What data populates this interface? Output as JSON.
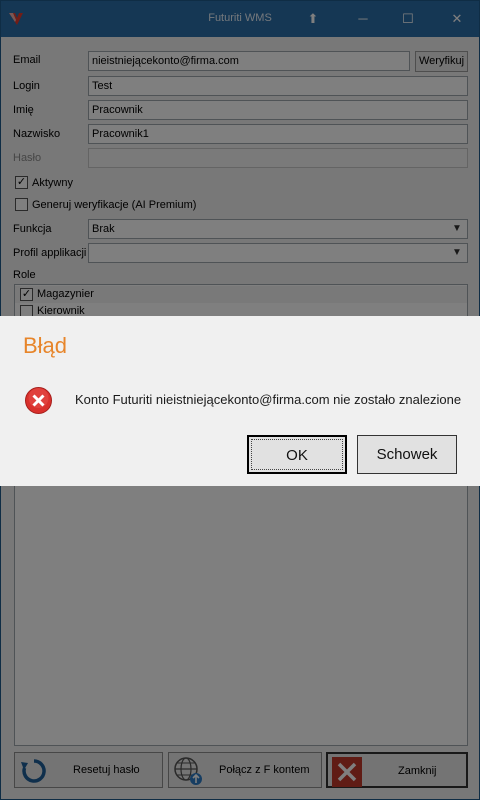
{
  "window": {
    "title": "Futuriti WMS",
    "controls": {
      "pin": "⬆",
      "minimize": "─",
      "maximize": "☐",
      "close": "✕"
    }
  },
  "form": {
    "email_label": "Email",
    "email_value": "nieistniejącekonto@firma.com",
    "verify_button": "Weryfikuj",
    "login_label": "Login",
    "login_value": "Test",
    "first_name_label": "Imię",
    "first_name_value": "Pracownik",
    "last_name_label": "Nazwisko",
    "last_name_value": "Pracownik1",
    "password_label": "Hasło",
    "password_value": "",
    "active_label": "Aktywny",
    "active_checked": true,
    "gen_verify_label": "Generuj weryfikacje (AI Premium)",
    "gen_verify_checked": false,
    "function_label": "Funkcja",
    "function_value": "Brak",
    "app_profile_label": "Profil applikacji",
    "app_profile_value": "",
    "roles_label": "Role",
    "roles": [
      {
        "label": "Magazynier",
        "checked": true
      },
      {
        "label": "Kierownik",
        "checked": false
      }
    ]
  },
  "bottom_buttons": {
    "reset_password": "Resetuj hasło",
    "connect_account": "Połącz z F kontem",
    "close": "Zamknij"
  },
  "dialog": {
    "title": "Błąd",
    "message": "Konto Futuriti nieistniejącekonto@firma.com nie zostało znalezione",
    "ok_button": "OK",
    "clipboard_button": "Schowek"
  },
  "colors": {
    "titlebar": "#2b6ea8",
    "dialog_title": "#e7852a",
    "error_icon": "#d9302c",
    "close_icon": "#c0392b"
  }
}
